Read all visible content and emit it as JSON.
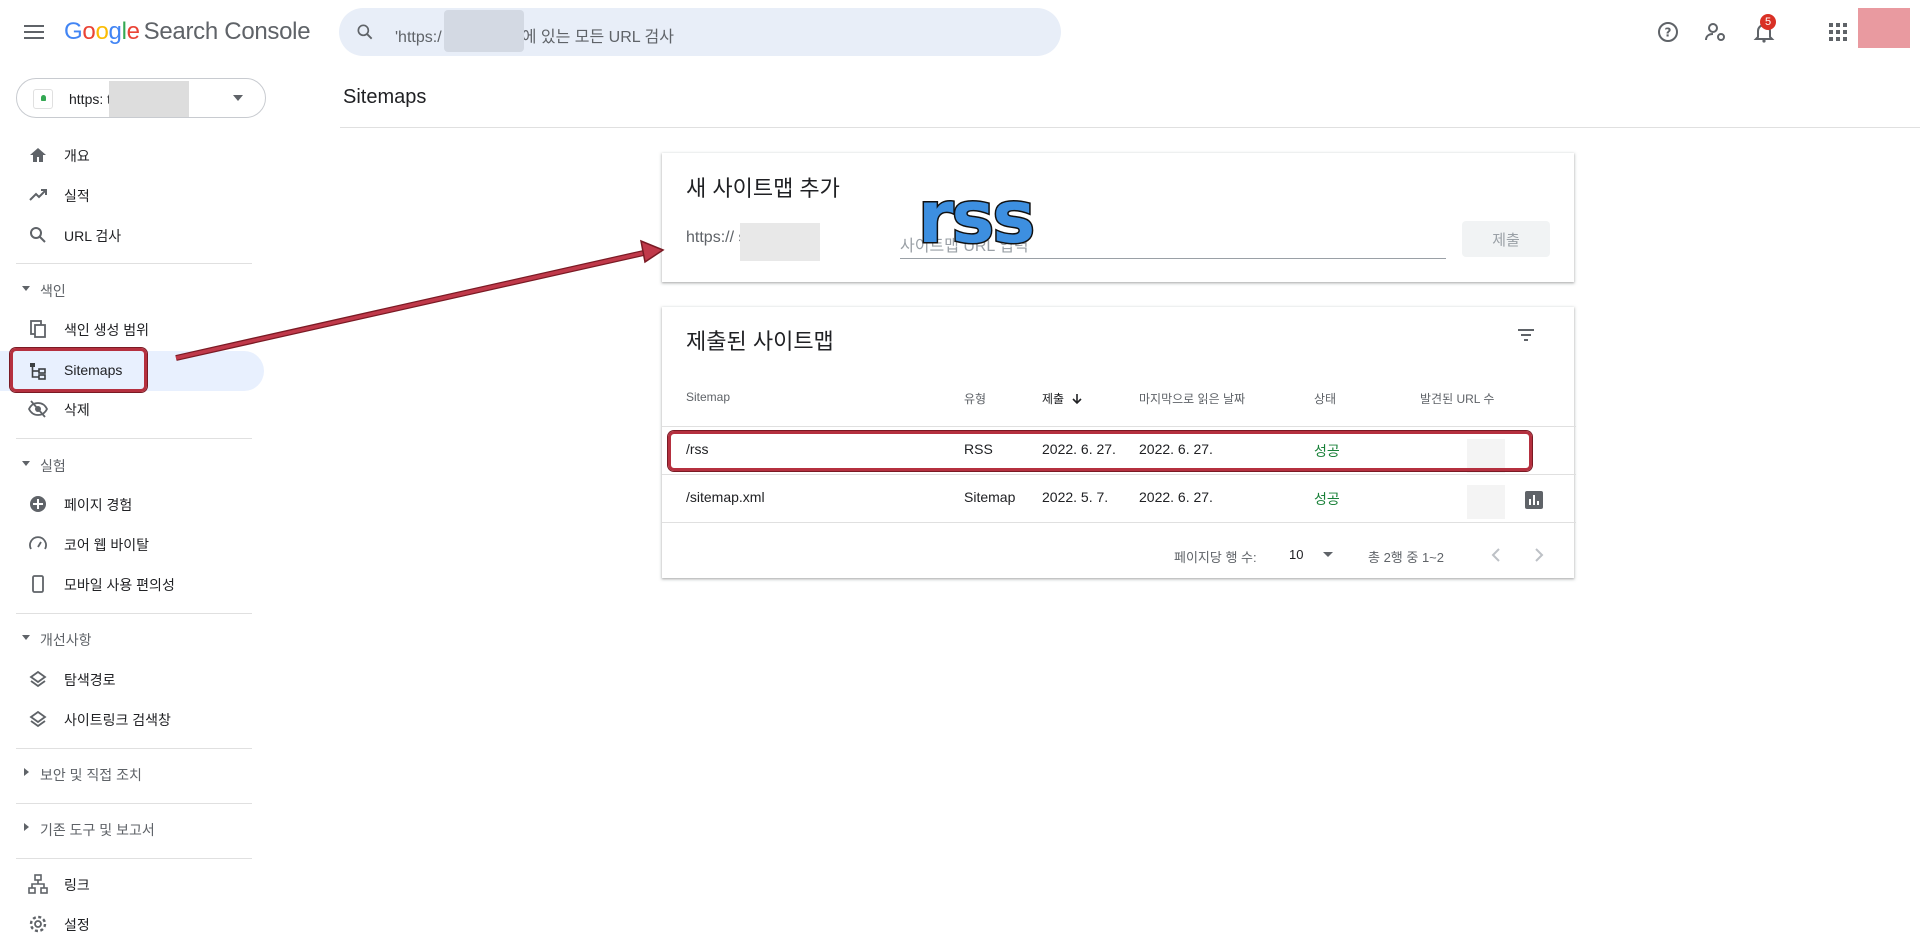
{
  "header": {
    "menu_icon": "hamburger-menu-icon",
    "logo_letters": [
      "G",
      "o",
      "o",
      "g",
      "l",
      "e"
    ],
    "product_name": "Search Console",
    "search_placeholder": "'https:/          story.com/'에 있는 모든 URL 검사",
    "icons": [
      "help-icon",
      "manage-users-icon",
      "notifications-icon",
      "apps-grid-icon"
    ],
    "notification_count": "5"
  },
  "property": {
    "label": "https:               to..."
  },
  "sidebar": {
    "overview": "개요",
    "performance": "실적",
    "url_inspection": "URL 검사",
    "index_section": "색인",
    "coverage": "색인 생성 범위",
    "sitemaps": "Sitemaps",
    "removals": "삭제",
    "experience_section": "실험",
    "page_experience": "페이지 경험",
    "core_web_vitals": "코어 웹 바이탈",
    "mobile_usability": "모바일 사용 편의성",
    "enhancements_section": "개선사항",
    "breadcrumbs": "탐색경로",
    "sitelinks_searchbox": "사이트링크 검색창",
    "security_section": "보안 및 직접 조치",
    "legacy_section": "기존 도구 및 보고서",
    "links": "링크",
    "settings": "설정"
  },
  "main": {
    "page_title": "Sitemaps",
    "add_card": {
      "title": "새 사이트맵 추가",
      "url_prefix": "https://            story.com/",
      "input_placeholder": "사이트맵 URL 입력",
      "submit_label": "제출",
      "overlay_text": "rss"
    },
    "submitted_card": {
      "title": "제출된 사이트맵",
      "filter_icon": "filter-icon",
      "columns": [
        "Sitemap",
        "유형",
        "제출",
        "마지막으로 읽은 날짜",
        "상태",
        "발견된 URL 수"
      ],
      "sort_icon": "arrow-down-icon",
      "rows": [
        {
          "sitemap": "/rss",
          "type": "RSS",
          "submitted": "2022. 6. 27.",
          "last_read": "2022. 6. 27.",
          "status": "성공"
        },
        {
          "sitemap": "/sitemap.xml",
          "type": "Sitemap",
          "submitted": "2022. 5. 7.",
          "last_read": "2022. 6. 27.",
          "status": "성공"
        }
      ],
      "rows_per_page_label": "페이지당 행 수:",
      "rows_per_page_value": "10",
      "range_label": "총 2행 중 1~2"
    }
  },
  "colors": {
    "accent": "#1a73e8",
    "active_nav": "#e8f0fe",
    "success": "#188038",
    "annotation": "#b5303f",
    "overlay_text": "#3d8fe0"
  }
}
